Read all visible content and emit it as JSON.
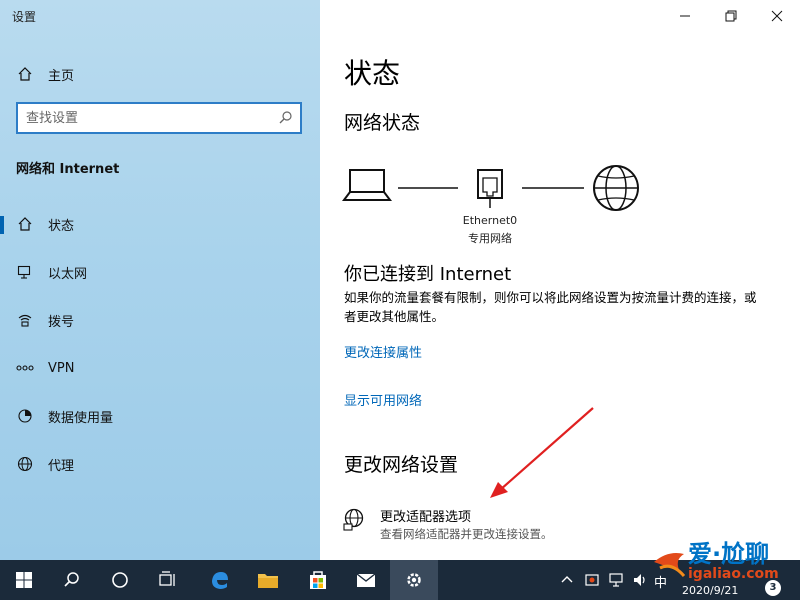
{
  "app_title": "设置",
  "sidebar": {
    "home_label": "主页",
    "search_placeholder": "查找设置",
    "category_title": "网络和 Internet",
    "items": [
      {
        "label": "状态",
        "icon": "home-status-icon",
        "active": true
      },
      {
        "label": "以太网",
        "icon": "ethernet-icon"
      },
      {
        "label": "拨号",
        "icon": "dialup-icon"
      },
      {
        "label": "VPN",
        "icon": "vpn-icon"
      },
      {
        "label": "数据使用量",
        "icon": "data-usage-icon"
      },
      {
        "label": "代理",
        "icon": "globe-icon"
      }
    ]
  },
  "content": {
    "title": "状态",
    "network_status_heading": "网络状态",
    "adapter_name": "Ethernet0",
    "network_type": "专用网络",
    "connected_heading": "你已连接到 Internet",
    "connected_desc": "如果你的流量套餐有限制，则你可以将此网络设置为按流量计费的连接，或者更改其他属性。",
    "link_change_properties": "更改连接属性",
    "link_show_networks": "显示可用网络",
    "change_settings_heading": "更改网络设置",
    "adapter_option_title": "更改适配器选项",
    "adapter_option_desc": "查看网络适配器并更改连接设置。"
  },
  "taskbar": {
    "ime": "中",
    "date": "2020/9/21",
    "notification_count": "3",
    "watermark_line1": "爱·尬聊",
    "watermark_line2": "igaliao.com"
  },
  "colors": {
    "accent": "#0063b1",
    "link": "#0067b8",
    "arrow": "#e02020",
    "taskbar": "#1b2a3a"
  }
}
